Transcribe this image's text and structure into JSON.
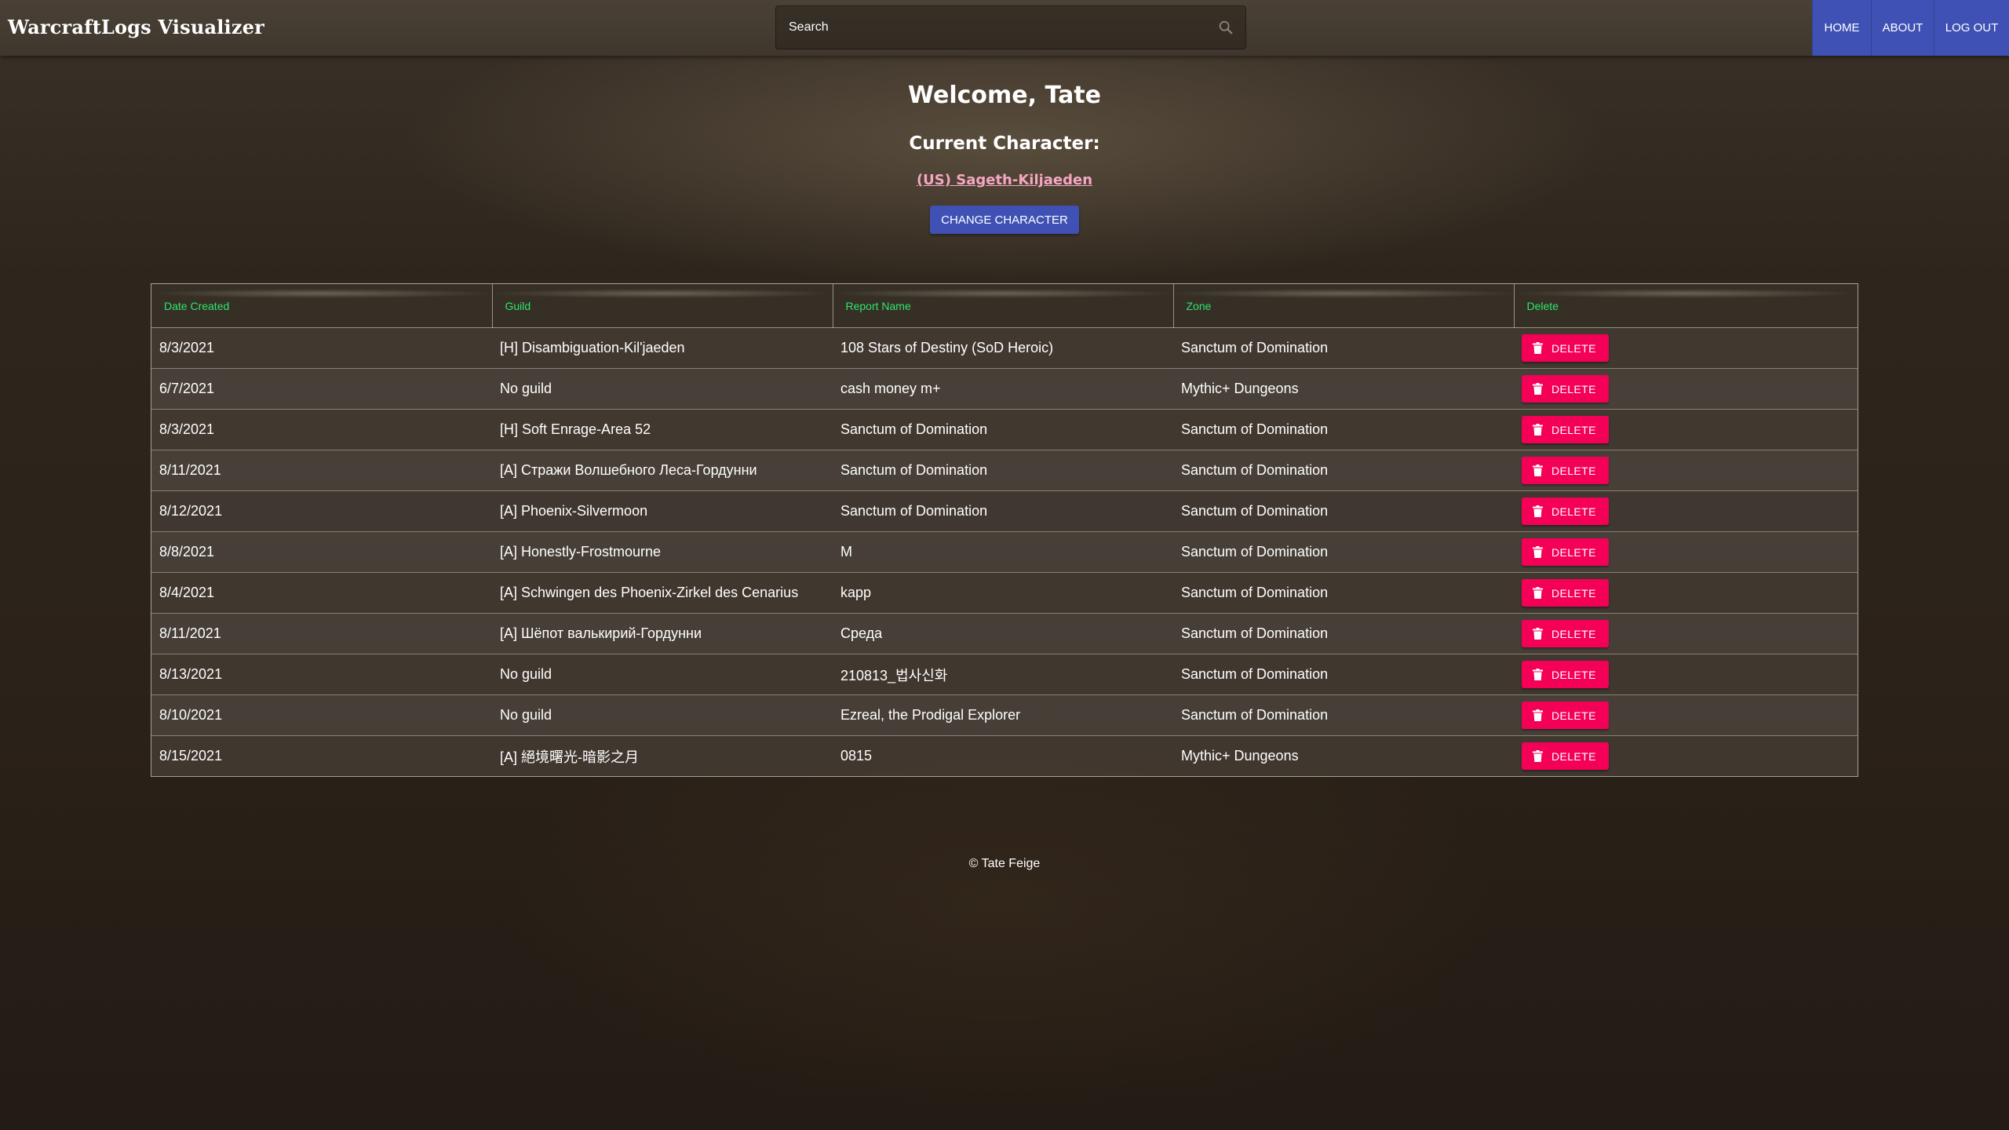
{
  "header": {
    "brand": "WarcraftLogs Visualizer",
    "search_placeholder": "Search",
    "nav": {
      "home": "HOME",
      "about": "ABOUT",
      "logout": "LOG OUT"
    }
  },
  "welcome": {
    "greeting": "Welcome, Tate",
    "current_character_label": "Current Character:",
    "character_name": "(US) Sageth-Kiljaeden",
    "change_button": "CHANGE CHARACTER"
  },
  "table": {
    "columns": [
      "Date Created",
      "Guild",
      "Report Name",
      "Zone",
      "Delete"
    ],
    "delete_label": "DELETE",
    "rows": [
      {
        "date": "8/3/2021",
        "guild": "[H] Disambiguation-Kil'jaeden",
        "report": "108 Stars of Destiny (SoD Heroic)",
        "zone": "Sanctum of Domination"
      },
      {
        "date": "6/7/2021",
        "guild": "No guild",
        "report": "cash money m+",
        "zone": "Mythic+ Dungeons"
      },
      {
        "date": "8/3/2021",
        "guild": "[H] Soft Enrage-Area 52",
        "report": "Sanctum of Domination",
        "zone": "Sanctum of Domination"
      },
      {
        "date": "8/11/2021",
        "guild": "[A] Стражи Волшебного Леса-Гордунни",
        "report": "Sanctum of Domination",
        "zone": "Sanctum of Domination"
      },
      {
        "date": "8/12/2021",
        "guild": "[A] Phoenix-Silvermoon",
        "report": "Sanctum of Domination",
        "zone": "Sanctum of Domination"
      },
      {
        "date": "8/8/2021",
        "guild": "[A] Honestly-Frostmourne",
        "report": "M",
        "zone": "Sanctum of Domination"
      },
      {
        "date": "8/4/2021",
        "guild": "[A] Schwingen des Phoenix-Zirkel des Cenarius",
        "report": "kapp",
        "zone": "Sanctum of Domination"
      },
      {
        "date": "8/11/2021",
        "guild": "[A] Шёпот валькирий-Гордунни",
        "report": "Среда",
        "zone": "Sanctum of Domination"
      },
      {
        "date": "8/13/2021",
        "guild": "No guild",
        "report": "210813_법사신화",
        "zone": "Sanctum of Domination"
      },
      {
        "date": "8/10/2021",
        "guild": "No guild",
        "report": "Ezreal, the Prodigal Explorer",
        "zone": "Sanctum of Domination"
      },
      {
        "date": "8/15/2021",
        "guild": "[A] 絕境曙光-暗影之月",
        "report": "0815",
        "zone": "Mythic+ Dungeons"
      }
    ]
  },
  "footer": {
    "copyright": "© Tate Feige"
  },
  "colors": {
    "primary": "#3f51b5",
    "danger": "#f50057",
    "header_text": "#2ee66a",
    "link": "#f5a7c2"
  },
  "icons": {
    "search": "search-icon",
    "delete": "trash-icon"
  }
}
